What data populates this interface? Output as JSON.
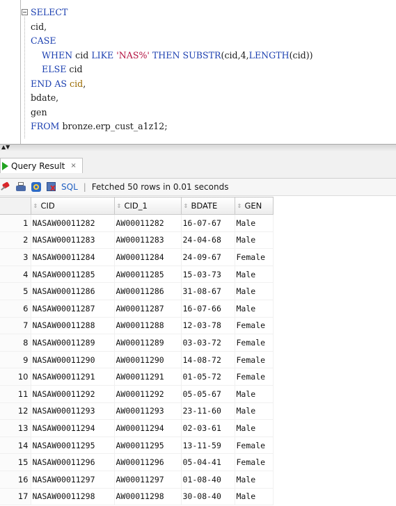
{
  "editor": {
    "lines": [
      {
        "parts": [
          {
            "t": "SELECT",
            "c": "kw"
          }
        ]
      },
      {
        "parts": [
          {
            "t": "cid,",
            "c": ""
          }
        ]
      },
      {
        "parts": [
          {
            "t": "CASE",
            "c": "kw"
          }
        ]
      },
      {
        "parts": [
          {
            "t": "    WHEN ",
            "c": "kw"
          },
          {
            "t": "cid ",
            "c": ""
          },
          {
            "t": "LIKE ",
            "c": "kw"
          },
          {
            "t": "'NAS%'",
            "c": "str"
          },
          {
            "t": " THEN ",
            "c": "kw"
          },
          {
            "t": "SUBSTR",
            "c": "fn"
          },
          {
            "t": "(cid,4,",
            "c": ""
          },
          {
            "t": "LENGTH",
            "c": "fn"
          },
          {
            "t": "(cid))",
            "c": ""
          }
        ]
      },
      {
        "parts": [
          {
            "t": "    ELSE ",
            "c": "kw"
          },
          {
            "t": "cid",
            "c": ""
          }
        ]
      },
      {
        "parts": [
          {
            "t": "END AS ",
            "c": "kw"
          },
          {
            "t": "cid",
            "c": "lit"
          },
          {
            "t": ",",
            "c": ""
          }
        ]
      },
      {
        "parts": [
          {
            "t": "bdate,",
            "c": ""
          }
        ]
      },
      {
        "parts": [
          {
            "t": "gen",
            "c": ""
          }
        ]
      },
      {
        "parts": [
          {
            "t": "FROM ",
            "c": "kw"
          },
          {
            "t": "bronze.erp_cust_a1z12;",
            "c": ""
          }
        ]
      }
    ]
  },
  "result_panel": {
    "tab_label": "Query Result",
    "tab_close": "×",
    "sql_label": "SQL",
    "separator": "|",
    "status_text": "Fetched 50 rows in 0.01 seconds"
  },
  "grid": {
    "columns": [
      "CID",
      "CID_1",
      "BDATE",
      "GEN"
    ],
    "rows": [
      [
        "1",
        "NASAW00011282",
        "AW00011282",
        "16-07-67",
        "Male"
      ],
      [
        "2",
        "NASAW00011283",
        "AW00011283",
        "24-04-68",
        "Male"
      ],
      [
        "3",
        "NASAW00011284",
        "AW00011284",
        "24-09-67",
        "Female"
      ],
      [
        "4",
        "NASAW00011285",
        "AW00011285",
        "15-03-73",
        "Male"
      ],
      [
        "5",
        "NASAW00011286",
        "AW00011286",
        "31-08-67",
        "Male"
      ],
      [
        "6",
        "NASAW00011287",
        "AW00011287",
        "16-07-66",
        "Male"
      ],
      [
        "7",
        "NASAW00011288",
        "AW00011288",
        "12-03-78",
        "Female"
      ],
      [
        "8",
        "NASAW00011289",
        "AW00011289",
        "03-03-72",
        "Female"
      ],
      [
        "9",
        "NASAW00011290",
        "AW00011290",
        "14-08-72",
        "Female"
      ],
      [
        "10",
        "NASAW00011291",
        "AW00011291",
        "01-05-72",
        "Female"
      ],
      [
        "11",
        "NASAW00011292",
        "AW00011292",
        "05-05-67",
        "Male"
      ],
      [
        "12",
        "NASAW00011293",
        "AW00011293",
        "23-11-60",
        "Male"
      ],
      [
        "13",
        "NASAW00011294",
        "AW00011294",
        "02-03-61",
        "Male"
      ],
      [
        "14",
        "NASAW00011295",
        "AW00011295",
        "13-11-59",
        "Female"
      ],
      [
        "15",
        "NASAW00011296",
        "AW00011296",
        "05-04-41",
        "Female"
      ],
      [
        "16",
        "NASAW00011297",
        "AW00011297",
        "01-08-40",
        "Male"
      ],
      [
        "17",
        "NASAW00011298",
        "AW00011298",
        "30-08-40",
        "Male"
      ]
    ]
  },
  "colors": {
    "keyword": "#1b3fb0",
    "string": "#b30f3e",
    "link": "#1f5fc2"
  },
  "icons": [
    "collapse-icon",
    "run-result-icon",
    "pin-icon",
    "printer-icon",
    "refresh-icon",
    "cancel-query-icon",
    "sort-icon"
  ]
}
